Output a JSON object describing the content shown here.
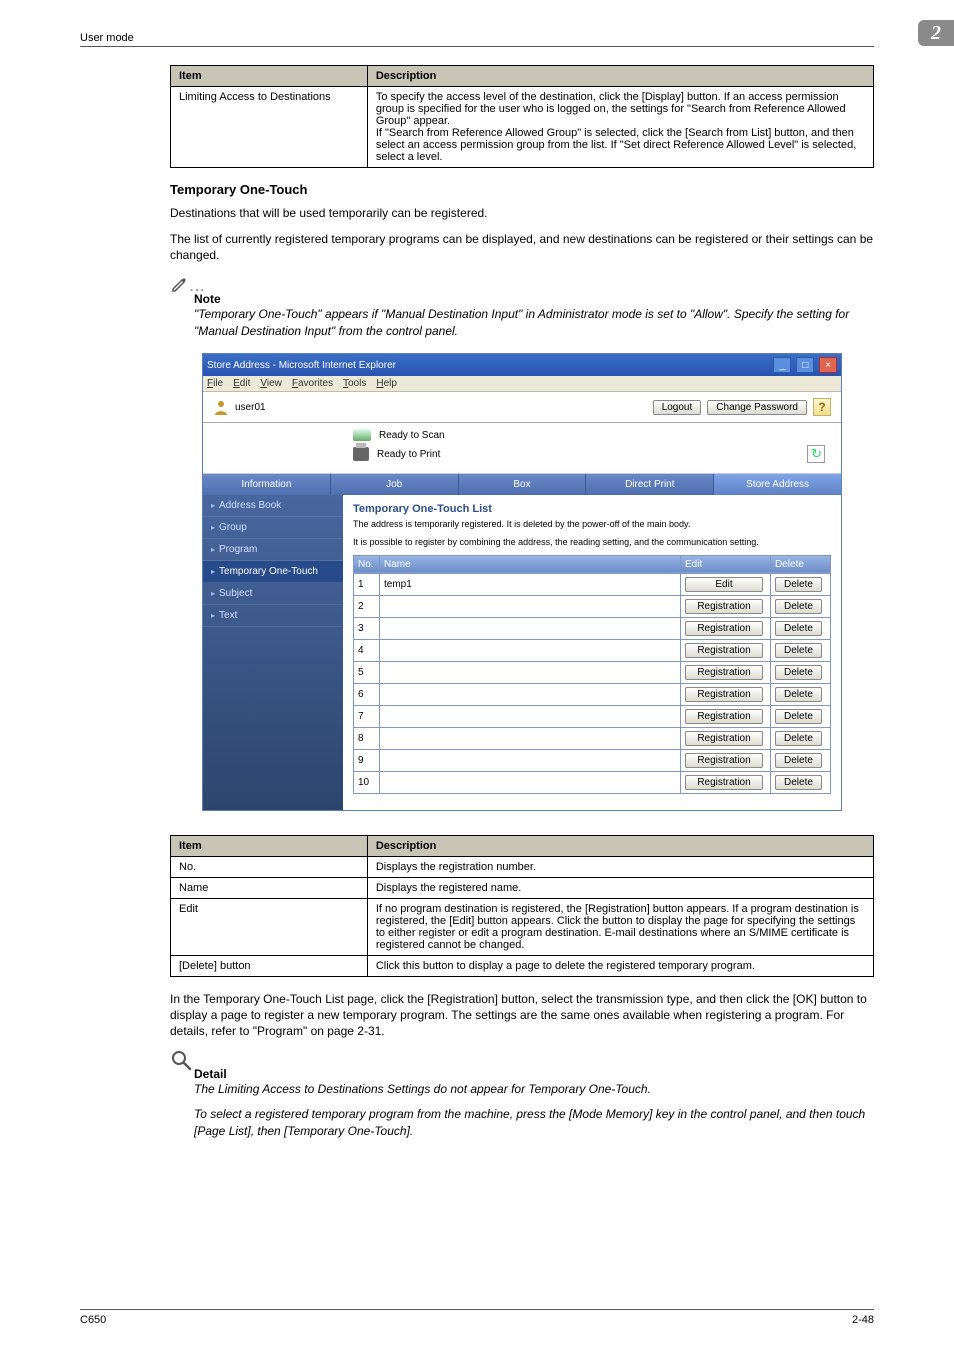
{
  "running_header": {
    "left": "User mode",
    "chapter": "2"
  },
  "table_top": {
    "head_item": "Item",
    "head_desc": "Description",
    "rows": [
      {
        "item": "Limiting Access to Destinations",
        "desc": "To specify the access level of the destination, click the [Display] button. If an access permission group is specified for the user who is logged on, the settings for \"Search from Reference Allowed Group\" appear.\nIf \"Search from Reference Allowed Group\" is selected, click the [Search from List] button, and then select an access permission group from the list. If \"Set direct Reference Allowed Level\" is selected, select a level."
      }
    ]
  },
  "section": {
    "heading": "Temporary One-Touch",
    "p1": "Destinations that will be used temporarily can be registered.",
    "p2": "The list of currently registered temporary programs can be displayed, and new destinations can be registered or their settings can be changed."
  },
  "note": {
    "label": "Note",
    "text": "\"Temporary One-Touch\" appears if \"Manual Destination Input\" in Administrator mode is set to \"Allow\". Specify the setting for \"Manual Destination Input\" from the control panel."
  },
  "screenshot": {
    "window_title": "Store Address - Microsoft Internet Explorer",
    "menu": [
      "File",
      "Edit",
      "View",
      "Favorites",
      "Tools",
      "Help"
    ],
    "user": "user01",
    "btn_logout": "Logout",
    "btn_changepw": "Change Password",
    "status_scan": "Ready to Scan",
    "status_print": "Ready to Print",
    "tabs": [
      "Information",
      "Job",
      "Box",
      "Direct Print",
      "Store Address"
    ],
    "side": [
      "Address Book",
      "Group",
      "Program",
      "Temporary One-Touch",
      "Subject",
      "Text"
    ],
    "list_title": "Temporary One-Touch List",
    "hint1": "The address is temporarily registered. It is deleted by the power-off of the main body.",
    "hint2": "It is possible to register by combining the address, the reading setting, and the communication setting.",
    "cols": {
      "no": "No.",
      "name": "Name",
      "edit": "Edit",
      "delete": "Delete"
    },
    "btn_edit": "Edit",
    "btn_reg": "Registration",
    "btn_del": "Delete",
    "slots": [
      {
        "no": "1",
        "name": "temp1",
        "has": true
      },
      {
        "no": "2",
        "name": "",
        "has": false
      },
      {
        "no": "3",
        "name": "",
        "has": false
      },
      {
        "no": "4",
        "name": "",
        "has": false
      },
      {
        "no": "5",
        "name": "",
        "has": false
      },
      {
        "no": "6",
        "name": "",
        "has": false
      },
      {
        "no": "7",
        "name": "",
        "has": false
      },
      {
        "no": "8",
        "name": "",
        "has": false
      },
      {
        "no": "9",
        "name": "",
        "has": false
      },
      {
        "no": "10",
        "name": "",
        "has": false
      }
    ]
  },
  "table_mid": {
    "head_item": "Item",
    "head_desc": "Description",
    "rows": [
      {
        "item": "No.",
        "desc": "Displays the registration number."
      },
      {
        "item": "Name",
        "desc": "Displays the registered name."
      },
      {
        "item": "Edit",
        "desc": "If no program destination is registered, the [Registration] button appears. If a program destination is registered, the [Edit] button appears. Click the button to display the page for specifying the settings to either register or edit a program destination. E-mail destinations where an S/MIME certificate is registered cannot be changed."
      },
      {
        "item": "[Delete] button",
        "desc": "Click this button to display a page to delete the registered temporary program."
      }
    ]
  },
  "after_table_p": "In the Temporary One-Touch List page, click the [Registration] button, select the transmission type, and then click the [OK] button to display a page to register a new temporary program. The settings are the same ones available when registering a program. For details, refer to \"Program\" on page 2-31.",
  "detail": {
    "label": "Detail",
    "p1": "The Limiting Access to Destinations Settings do not appear for Temporary One-Touch.",
    "p2": "To select a registered temporary program from the machine, press the [Mode Memory] key in the control panel, and then touch [Page List], then [Temporary One-Touch]."
  },
  "footer": {
    "left": "C650",
    "right": "2-48"
  }
}
